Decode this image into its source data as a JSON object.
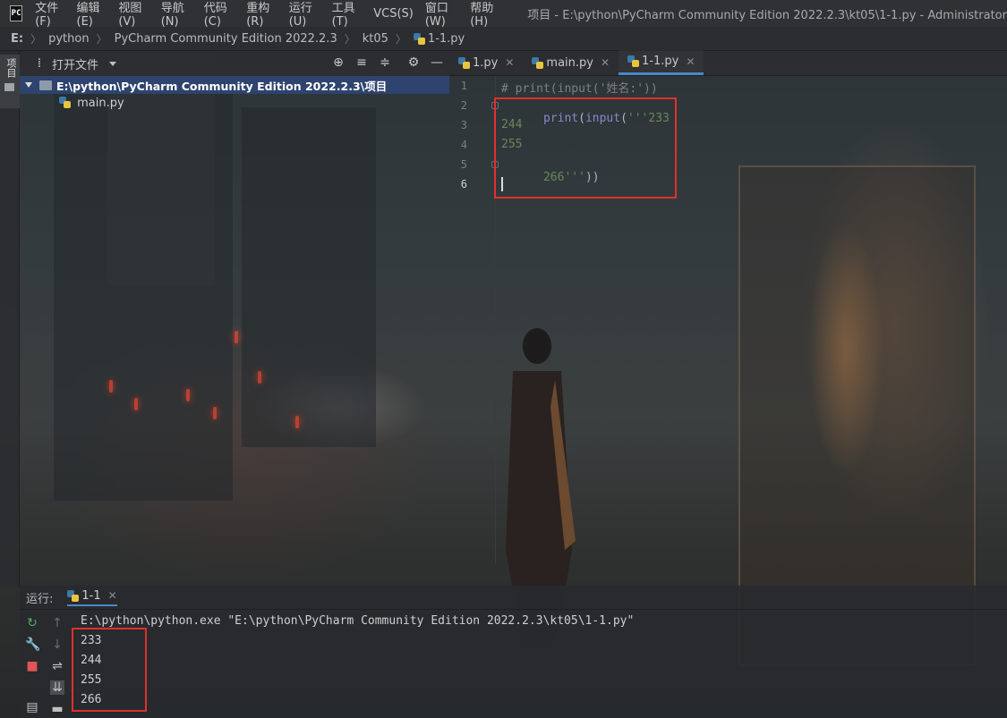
{
  "menubar": {
    "logo": "PC",
    "items": [
      "文件(F)",
      "编辑(E)",
      "视图(V)",
      "导航(N)",
      "代码(C)",
      "重构(R)",
      "运行(U)",
      "工具(T)",
      "VCS(S)",
      "窗口(W)",
      "帮助(H)"
    ],
    "window_title": "项目 - E:\\python\\PyCharm Community Edition 2022.2.3\\kt05\\1-1.py - Administrator"
  },
  "navbar": {
    "crumbs": [
      "E:",
      "python",
      "PyCharm Community Edition 2022.2.3",
      "kt05",
      "1-1.py"
    ]
  },
  "left_strip": {
    "label": "项目"
  },
  "project_panel": {
    "title": "打开文件",
    "root": "E:\\python\\PyCharm Community Edition 2022.2.3\\项目",
    "child": "main.py"
  },
  "editor": {
    "tabs": [
      {
        "label": "1.py",
        "active": false
      },
      {
        "label": "main.py",
        "active": false
      },
      {
        "label": "1-1.py",
        "active": true
      }
    ],
    "lines": {
      "l1": "# print(input('姓名:'))",
      "l2_kw1": "print",
      "l2_p1": "(",
      "l2_kw2": "input",
      "l2_p2": "(",
      "l2_str": "'''233",
      "l3": "244",
      "l4": "255",
      "l5_str": "266'''",
      "l5_p": "))"
    },
    "line_numbers": [
      "1",
      "2",
      "3",
      "4",
      "5",
      "6"
    ]
  },
  "run_panel": {
    "label": "运行:",
    "tab": "1-1",
    "command": "E:\\python\\python.exe \"E:\\python\\PyCharm Community Edition 2022.2.3\\kt05\\1-1.py\"",
    "output": [
      "233",
      "244",
      "255",
      "266"
    ]
  },
  "colors": {
    "highlight_border": "#e03030",
    "selected_tree_row": "#2e436e",
    "active_tab_underline": "#4a88c7"
  }
}
